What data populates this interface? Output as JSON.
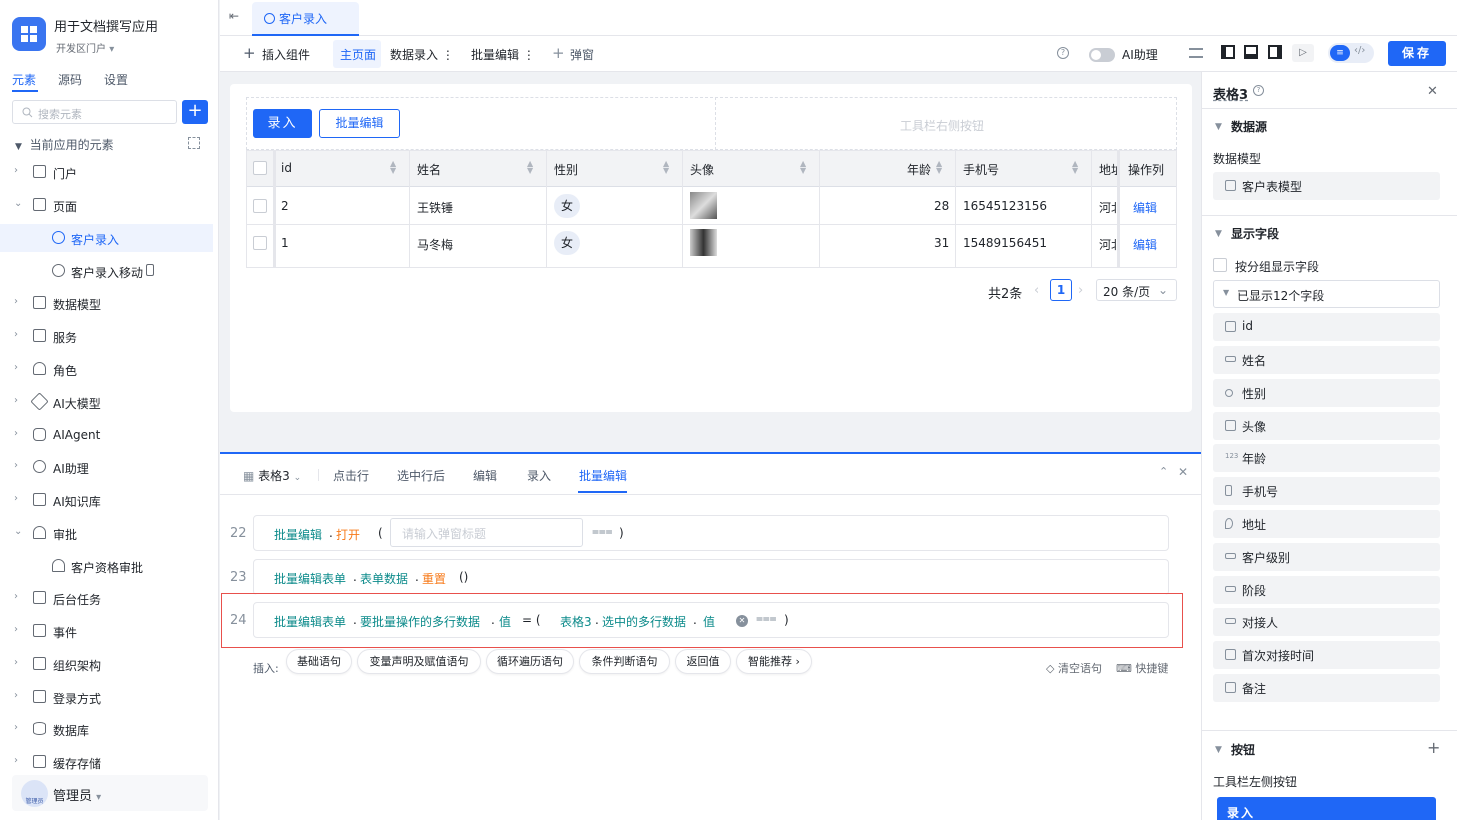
{
  "app": {
    "title": "用于文档撰写应用",
    "subtitle": "开发区门户"
  },
  "left_tabs": [
    "元素",
    "源码",
    "设置"
  ],
  "search": {
    "placeholder": "搜索元素"
  },
  "section_title": "当前应用的元素",
  "nav": [
    {
      "label": "门户",
      "icon": "portal-icon"
    },
    {
      "label": "页面",
      "icon": "page-icon"
    },
    {
      "label": "客户录入",
      "icon": "form-icon"
    },
    {
      "label": "客户录入移动",
      "icon": "form-icon"
    },
    {
      "label": "数据模型",
      "icon": "table-icon"
    },
    {
      "label": "服务",
      "icon": "service-icon"
    },
    {
      "label": "角色",
      "icon": "role-icon"
    },
    {
      "label": "AI大模型",
      "icon": "ai-model-icon"
    },
    {
      "label": "AIAgent",
      "icon": "robot-icon"
    },
    {
      "label": "AI助理",
      "icon": "assistant-icon"
    },
    {
      "label": "AI知识库",
      "icon": "book-icon"
    },
    {
      "label": "审批",
      "icon": "approval-icon"
    },
    {
      "label": "客户资格审批",
      "icon": "approval-icon"
    },
    {
      "label": "后台任务",
      "icon": "task-icon"
    },
    {
      "label": "事件",
      "icon": "event-icon"
    },
    {
      "label": "组织架构",
      "icon": "org-icon"
    },
    {
      "label": "登录方式",
      "icon": "login-icon"
    },
    {
      "label": "数据库",
      "icon": "database-icon"
    },
    {
      "label": "缓存存储",
      "icon": "cache-icon"
    }
  ],
  "user": {
    "name": "管理员",
    "avatar_text": "管理员"
  },
  "tab": {
    "label": "客户录入"
  },
  "toolbar": {
    "insert": "插入组件",
    "main_page": "主页面",
    "data_entry": "数据录入",
    "batch_edit": "批量编辑",
    "popup": "弹窗",
    "ai_assistant": "AI助理",
    "save": "保存"
  },
  "table": {
    "btn_entry": "录入",
    "btn_batch": "批量编辑",
    "right_placeholder": "工具栏右侧按钮",
    "columns": [
      "id",
      "姓名",
      "性别",
      "头像",
      "年龄",
      "手机号",
      "地址",
      "操作列"
    ],
    "rows": [
      {
        "id": "2",
        "name": "王铁锤",
        "gender": "女",
        "age": "28",
        "phone": "16545123156",
        "addr": "河北",
        "action": "编辑"
      },
      {
        "id": "1",
        "name": "马冬梅",
        "gender": "女",
        "age": "31",
        "phone": "15489156451",
        "addr": "河北",
        "action": "编辑"
      }
    ],
    "total": "共2条",
    "page": "1",
    "page_size": "20 条/页"
  },
  "bottom": {
    "tabs": [
      "表格3",
      "点击行",
      "选中行后",
      "编辑",
      "录入",
      "批量编辑"
    ],
    "lines": [
      {
        "num": "22",
        "a": "批量编辑",
        "b": "打开",
        "open": "(",
        "placeholder": "请输入弹窗标题",
        "close": ")"
      },
      {
        "num": "23",
        "a": "批量编辑表单",
        "b": "表单数据",
        "c": "重置",
        "paren": "()"
      },
      {
        "num": "24",
        "a": "批量编辑表单",
        "b": "要批量操作的多行数据",
        "c": "值",
        "eq": "= (",
        "d": "表格3",
        "e": "选中的多行数据",
        "f": "值",
        "close": ")"
      }
    ],
    "insert_label": "插入:",
    "chips": [
      "基础语句",
      "变量声明及赋值语句",
      "循环遍历语句",
      "条件判断语句",
      "返回值",
      "智能推荐"
    ],
    "clear": "清空语句",
    "shortcut": "快捷键"
  },
  "right": {
    "title": "表格3",
    "datasource": "数据源",
    "data_model_label": "数据模型",
    "data_model": "客户表模型",
    "display_fields": "显示字段",
    "group_fields": "按分组显示字段",
    "shown_count": "已显示12个字段",
    "fields": [
      "id",
      "姓名",
      "性别",
      "头像",
      "年龄",
      "手机号",
      "地址",
      "客户级别",
      "阶段",
      "对接人",
      "首次对接时间",
      "备注"
    ],
    "buttons": "按钮",
    "toolbar_left": "工具栏左侧按钮",
    "entry_button": "录入"
  },
  "colors": {
    "accent": "#1f67f6",
    "code_teal": "#0b8a8a",
    "code_orange": "#f77a1a",
    "highlight_red": "#e8504c"
  }
}
